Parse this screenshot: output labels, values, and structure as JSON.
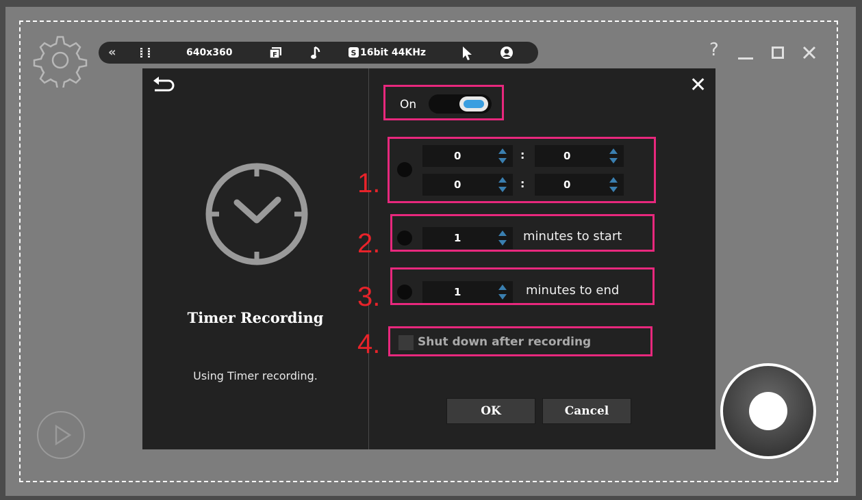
{
  "toolbar": {
    "resolution": "640x360",
    "audio": "16bit 44KHz"
  },
  "window": {
    "help": "?"
  },
  "dialog": {
    "title": "Timer Recording",
    "description": "Using Timer recording.",
    "toggle_label": "On",
    "toggle_state": true,
    "option1": {
      "marker": "1.",
      "start_hour": "0",
      "start_minute": "0",
      "end_hour": "0",
      "end_minute": "0",
      "separator": ":"
    },
    "option2": {
      "marker": "2.",
      "value": "1",
      "label": "minutes to start"
    },
    "option3": {
      "marker": "3.",
      "value": "1",
      "label": "minutes to end"
    },
    "option4": {
      "marker": "4.",
      "label": "Shut down after recording"
    },
    "ok_label": "OK",
    "cancel_label": "Cancel"
  },
  "colors": {
    "highlight": "#e8287d",
    "marker": "#e8232a",
    "toggle_accent": "#3a9ee0",
    "spinner_arrow": "#3a9ee0"
  }
}
